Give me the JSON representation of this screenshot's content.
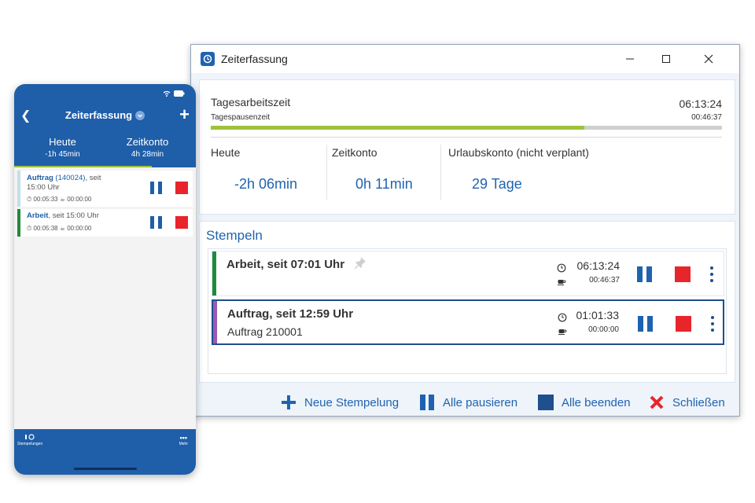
{
  "window": {
    "title": "Zeiterfassung",
    "app_icon": "clock-app-icon",
    "controls": [
      "minimize-icon",
      "maximize-icon",
      "close-icon"
    ]
  },
  "summary": {
    "tages_label": "Tagesarbeitszeit",
    "tages_time": "06:13:24",
    "pause_label": "Tagespausenzeit",
    "pause_time": "00:46:37",
    "progress_fraction": 0.73,
    "heute_label": "Heute",
    "heute_value": "-2h 06min",
    "zeitkonto_label": "Zeitkonto",
    "zeitkonto_value": "0h 11min",
    "urlaub_label": "Urlaubskonto (nicht verplant)",
    "urlaub_value": "29 Tage"
  },
  "stempeln": {
    "title": "Stempeln",
    "entries": [
      {
        "title": "Arbeit, seit 07:01 Uhr",
        "subtitle": "",
        "time": "06:13:24",
        "pause": "00:46:37",
        "color": "#1e8a3c",
        "pinned": true
      },
      {
        "title": "Auftrag, seit 12:59 Uhr",
        "subtitle": "Auftrag 210001",
        "time": "01:01:33",
        "pause": "00:00:00",
        "color": "#9b59b6",
        "selected": true
      }
    ]
  },
  "footer": {
    "new_label": "Neue Stempelung",
    "pause_all_label": "Alle pausieren",
    "end_all_label": "Alle beenden",
    "close_label": "Schließen"
  },
  "phone": {
    "title": "Zeiterfassung",
    "heute_label": "Heute",
    "heute_value": "-1h 45min",
    "zeitkonto_label": "Zeitkonto",
    "zeitkonto_value": "4h 28min",
    "entries": [
      {
        "title_bold": "Auftrag",
        "title_num": "(140024)",
        "title_rest": ", seit",
        "title_line2": "15:00 Uhr",
        "time": "00:05:33",
        "pause": "00:00:00",
        "color": "#bfe0ea"
      },
      {
        "title_bold": "Arbeit",
        "title_rest": ", seit 15:00 Uhr",
        "time": "00:05:38",
        "pause": "00:00:00",
        "color": "#1e8a3c"
      }
    ],
    "tabs": [
      "Stempelungen",
      "Mehr"
    ]
  },
  "colors": {
    "brand_blue": "#1f63b0",
    "stop_red": "#e8252b",
    "progress_green": "#9ec33a"
  }
}
